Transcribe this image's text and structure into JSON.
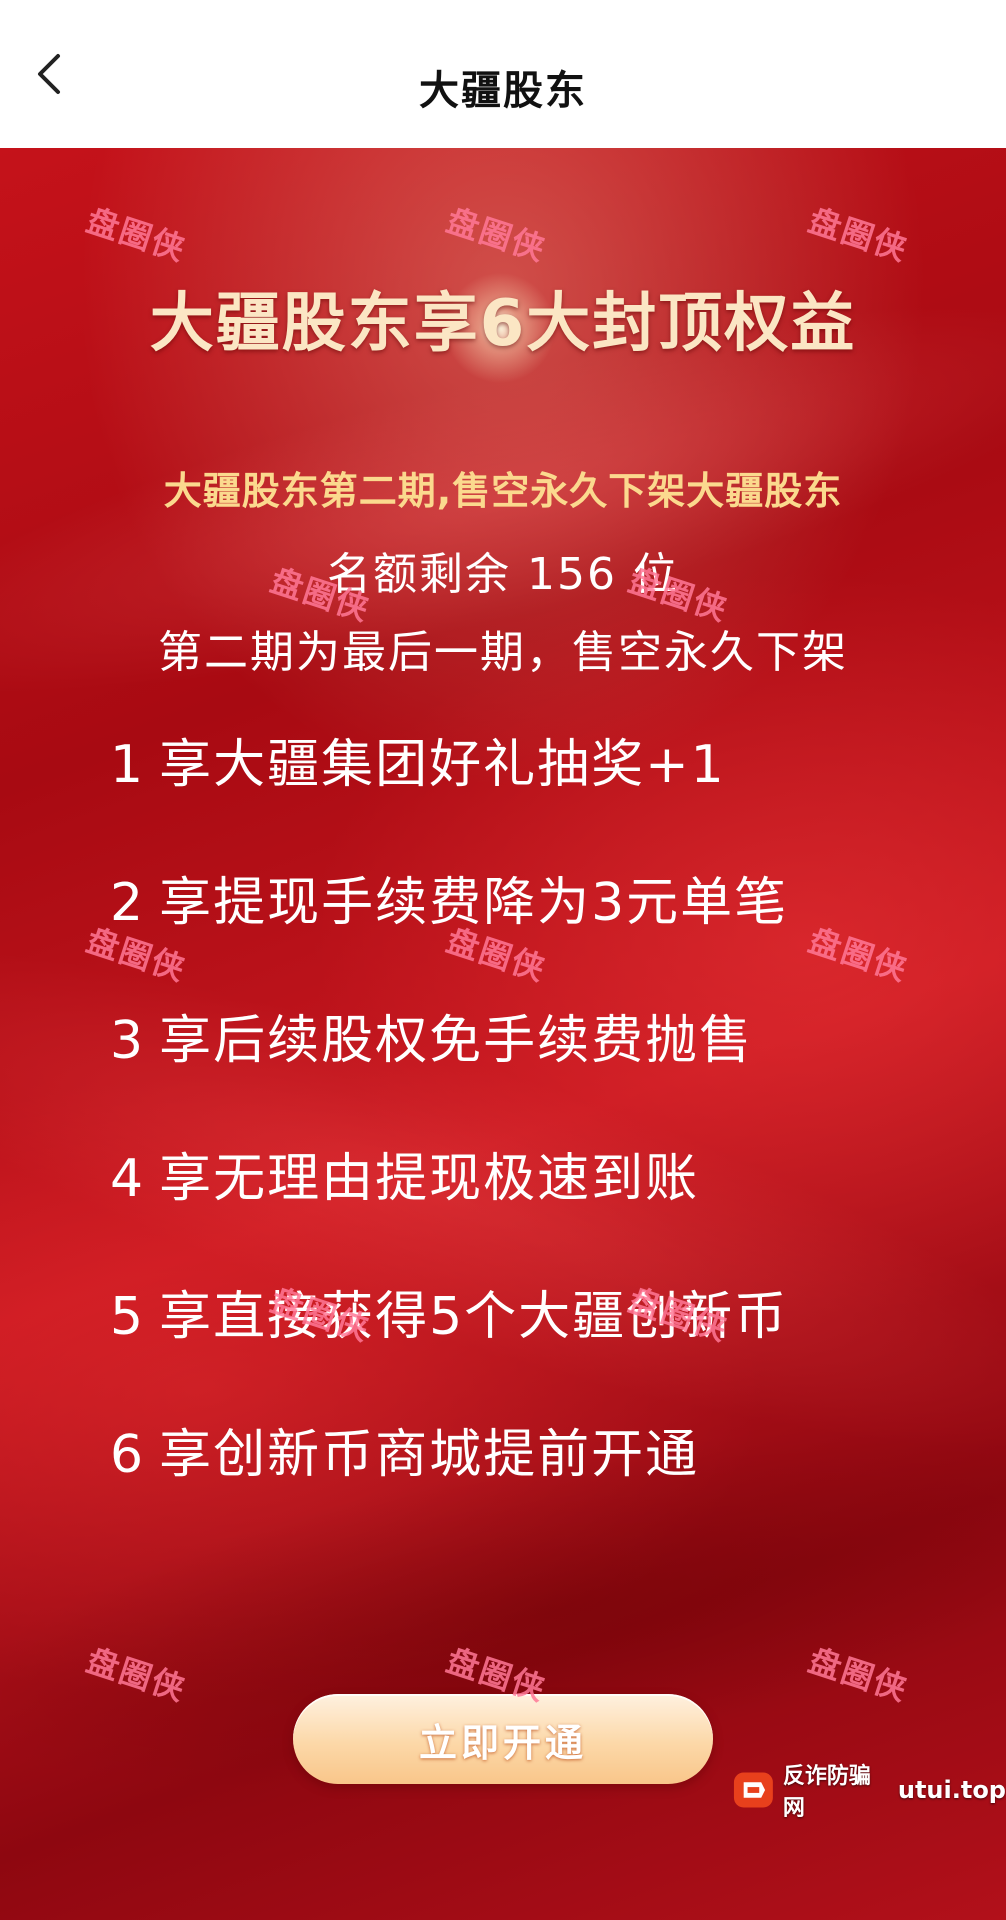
{
  "header": {
    "title": "大疆股东"
  },
  "poster": {
    "headline": "大疆股东享6大封顶权益",
    "subheadline": "大疆股东第二期,售空永久下架大疆股东",
    "quota": "名额剩余 156 位",
    "final_note": "第二期为最后一期，售空永久下架",
    "benefits": [
      {
        "num": "1",
        "text": "享大疆集团好礼抽奖+1"
      },
      {
        "num": "2",
        "text": "享提现手续费降为3元单笔"
      },
      {
        "num": "3",
        "text": "享后续股权免手续费抛售"
      },
      {
        "num": "4",
        "text": "享无理由提现极速到账"
      },
      {
        "num": "5",
        "text": "享直接获得5个大疆创新币"
      },
      {
        "num": "6",
        "text": "享创新币商城提前开通"
      }
    ],
    "cta_label": "立即开通"
  },
  "watermark": {
    "text": "盘圈侠"
  },
  "badge": {
    "label": "反诈防骗网",
    "site": "utui.top"
  },
  "colors": {
    "poster_red": "#c5121a",
    "headline_cream": "#fbe6c4",
    "subheadline_gold": "#fbd98e",
    "button_peach": "#fcd8a8",
    "watermark_pink": "#ff7896"
  },
  "icons": {
    "back": "chevron-left-icon",
    "badge_logo": "anti-fraud-logo-icon"
  }
}
